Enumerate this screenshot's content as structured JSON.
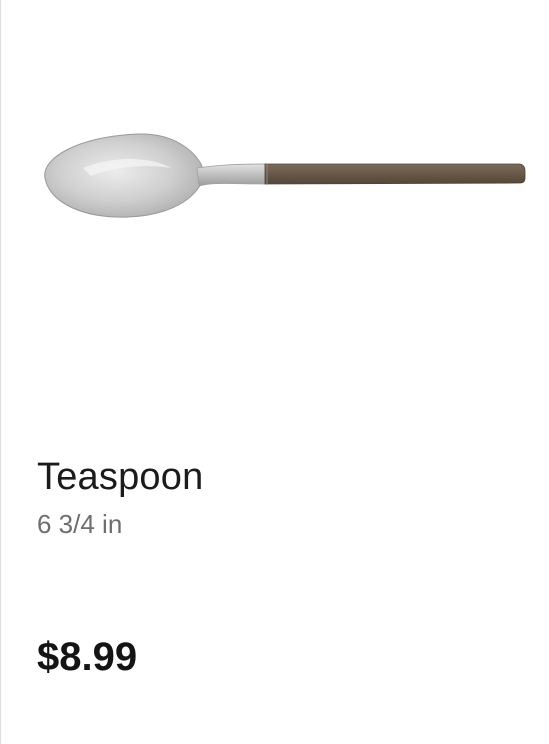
{
  "product": {
    "name": "Teaspoon",
    "size": "6 3/4 in",
    "price": "$8.99",
    "image_icon": "spoon-icon"
  },
  "colors": {
    "bowl_metal": "#c9c9c9",
    "handle_wood": "#6b5c4c",
    "name_text": "#1b1b1b",
    "size_text": "#6e6e6e",
    "price_text": "#141414",
    "card_border": "#dedede"
  }
}
